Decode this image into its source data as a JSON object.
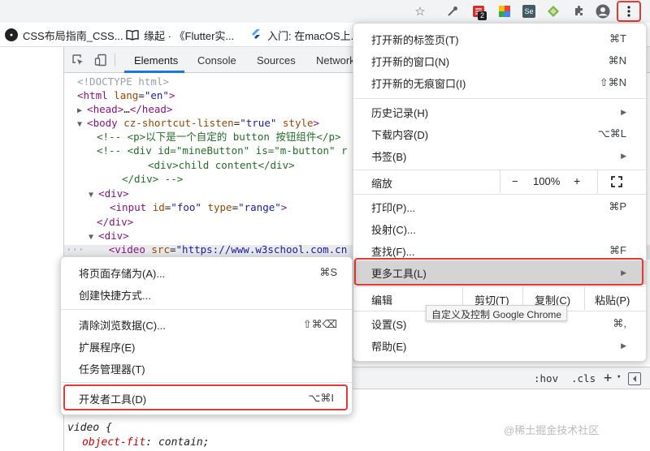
{
  "toolbar": {
    "icons": [
      "star-icon",
      "eyedropper-icon",
      "extension-icon-1",
      "extension-icon-2",
      "se-icon",
      "diamond-icon",
      "puzzle-icon",
      "profile-icon",
      "kebab-menu-icon"
    ],
    "badge": "2",
    "se_label": "Se"
  },
  "bookmarks": [
    {
      "label": "CSS布局指南_CSS...",
      "icon": "site-icon"
    },
    {
      "label": "缘起 · 《Flutter实...",
      "icon": "book-icon"
    },
    {
      "label": "入门: 在macOS上...",
      "icon": "flutter-icon"
    }
  ],
  "devtools": {
    "tabs": [
      "Elements",
      "Console",
      "Sources",
      "Network"
    ],
    "active_tab": "Elements",
    "code_lines": {
      "l1": "<!DOCTYPE html>",
      "l2_tag": "html",
      "l2_attr": "lang",
      "l2_val": "\"en\"",
      "l3": "head",
      "l4_tag": "body",
      "l4_attr1": "cz-shortcut-listen",
      "l4_val1": "\"true\"",
      "l4_attr2": "style",
      "l5": "<!-- <p>以下是一个自定的 button 按钮组件</p>",
      "l6": "<!-- <div id=\"mineButton\" is=\"m-button\" r",
      "l7": "<div>child content</div>",
      "l8": "</div> -->",
      "l9": "div",
      "l10_tag": "input",
      "l10_attr1": "id",
      "l10_val1": "\"foo\"",
      "l10_attr2": "type",
      "l10_val2": "\"range\"",
      "l11": "div",
      "l12": "div",
      "l13_tag": "video",
      "l13_attr": "src",
      "l13_val": "\"https://www.w3school.com.cn"
    },
    "styles": {
      "hov": ":hov",
      "cls": ".cls",
      "plus": "+",
      "selector": "video {",
      "property": "object-fit",
      "value": "contain;"
    }
  },
  "main_menu": {
    "items": [
      {
        "label": "打开新的标签页(T)",
        "shortcut": "⌘T"
      },
      {
        "label": "打开新的窗口(N)",
        "shortcut": "⌘N"
      },
      {
        "label": "打开新的无痕窗口(I)",
        "shortcut": "⇧⌘N"
      },
      {
        "label": "历史记录(H)",
        "shortcut": ""
      },
      {
        "label": "下载内容(D)",
        "shortcut": "⌥⌘L"
      },
      {
        "label": "书签(B)",
        "shortcut": ""
      },
      {
        "label": "打印(P)...",
        "shortcut": "⌘P"
      },
      {
        "label": "投射(C)...",
        "shortcut": ""
      },
      {
        "label": "查找(F)...",
        "shortcut": "⌘F"
      },
      {
        "label": "更多工具(L)",
        "shortcut": ""
      },
      {
        "label": "设置(S)",
        "shortcut": "⌘,"
      },
      {
        "label": "帮助(E)",
        "shortcut": ""
      }
    ],
    "zoom": {
      "label": "缩放",
      "minus": "−",
      "value": "100%",
      "plus": "+",
      "fullscreen": "fullscreen-icon"
    },
    "edit": {
      "label": "编辑",
      "cut": "剪切(T)",
      "copy": "复制(C)",
      "paste": "粘贴(P)"
    },
    "tooltip": "自定义及控制 Google Chrome"
  },
  "sub_menu": {
    "items": [
      {
        "label": "将页面存储为(A)...",
        "shortcut": "⌘S"
      },
      {
        "label": "创建快捷方式...",
        "shortcut": ""
      },
      {
        "label": "清除浏览数据(C)...",
        "shortcut": "⇧⌘⌫"
      },
      {
        "label": "扩展程序(E)",
        "shortcut": ""
      },
      {
        "label": "任务管理器(T)",
        "shortcut": ""
      },
      {
        "label": "开发者工具(D)",
        "shortcut": "⌥⌘I"
      }
    ]
  },
  "watermark": "@稀土掘金技术社区",
  "colors": {
    "highlight_box": "#e53935",
    "active_tab_underline": "#1a73e8"
  }
}
